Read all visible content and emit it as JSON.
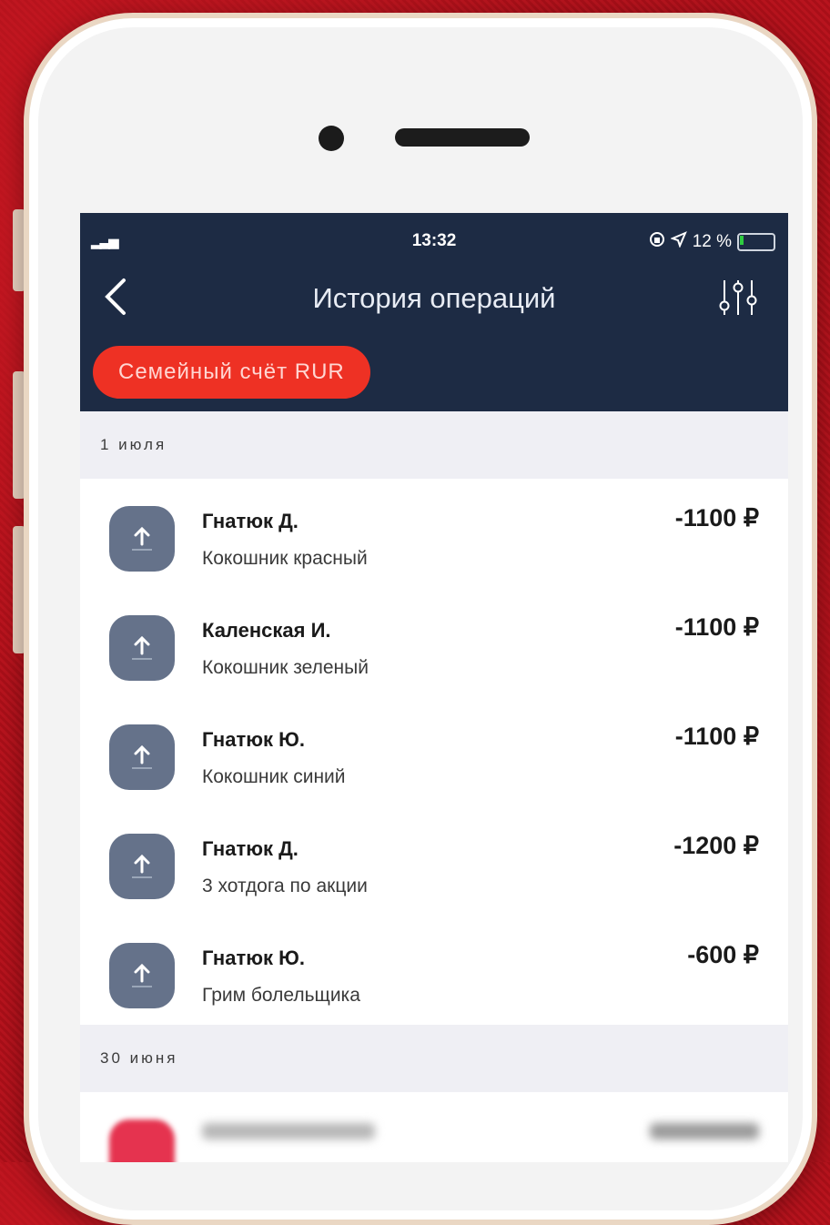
{
  "status": {
    "time": "13:32",
    "battery_percent_label": "12 %",
    "battery_level": 0.12
  },
  "header": {
    "title": "История операций",
    "account_chip": "Семейный счёт RUR"
  },
  "sections": [
    {
      "date": "1 июля",
      "transactions": [
        {
          "name": "Гнатюк Д.",
          "description": "Кокошник красный",
          "amount": "-1100 ₽"
        },
        {
          "name": "Каленская И.",
          "description": "Кокошник зеленый",
          "amount": "-1100 ₽"
        },
        {
          "name": "Гнатюк Ю.",
          "description": "Кокошник синий",
          "amount": "-1100 ₽"
        },
        {
          "name": "Гнатюк Д.",
          "description": "3 хотдога по акции",
          "amount": "-1200 ₽"
        },
        {
          "name": "Гнатюк Ю.",
          "description": "Грим болельщика",
          "amount": "-600 ₽"
        }
      ]
    },
    {
      "date": "30 июня"
    }
  ],
  "colors": {
    "background_red": "#b8141e",
    "header_navy": "#1d2b44",
    "chip_red": "#ee3124",
    "tx_icon": "#65728a"
  },
  "icons": {
    "back": "chevron-left-icon",
    "filter": "sliders-icon",
    "transaction": "arrow-up-icon",
    "location": "location-arrow-icon",
    "lock": "rotation-lock-icon"
  }
}
